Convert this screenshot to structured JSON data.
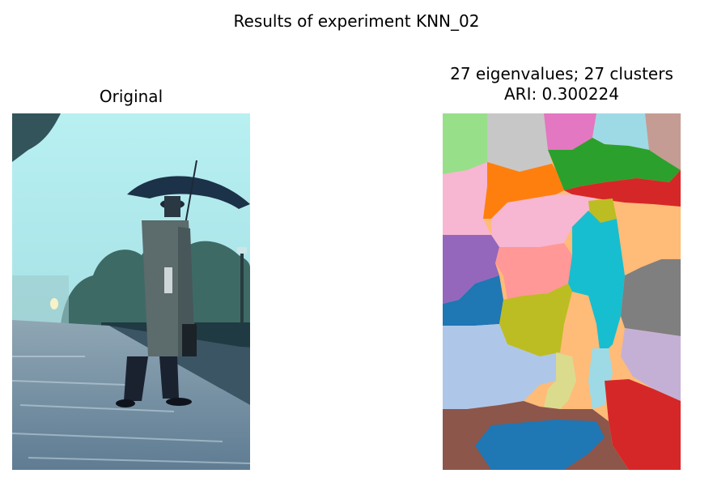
{
  "figure": {
    "suptitle": "Results of experiment KNN_02"
  },
  "left_panel": {
    "title": "Original",
    "image_description_icon": "photo-man-with-umbrella-on-rainy-platform"
  },
  "right_panel": {
    "title_line1": "27 eigenvalues; 27 clusters",
    "title_line2": "ARI: 0.300224",
    "image_description_icon": "cluster-segmentation-map"
  },
  "colors": {
    "sky": "#a8e6ec",
    "trees": "#3e6a66",
    "platform": "#7e97a8",
    "coat": "#5c6b6c",
    "tab_green_light": "#98df8a",
    "tab_gray_light": "#c7c7c7",
    "tab_pink": "#e377c2",
    "tab_cyan_light": "#9edae5",
    "tab_brown_light": "#c49c94",
    "tab_pink_light": "#f7b6d2",
    "tab_orange": "#ff7f0e",
    "tab_green": "#2ca02c",
    "tab_red": "#d62728",
    "tab_olive": "#bcbd22",
    "tab_peach": "#ffbb78",
    "tab_purple": "#9467bd",
    "tab_salmon": "#ff9896",
    "tab_cyan": "#17becf",
    "tab_gray": "#7f7f7f",
    "tab_blue": "#1f77b4",
    "tab_blue_light": "#aec7e8",
    "tab_olive_light": "#dbdb8d",
    "tab_lavender": "#c5b0d5",
    "tab_brown": "#8c564b"
  }
}
